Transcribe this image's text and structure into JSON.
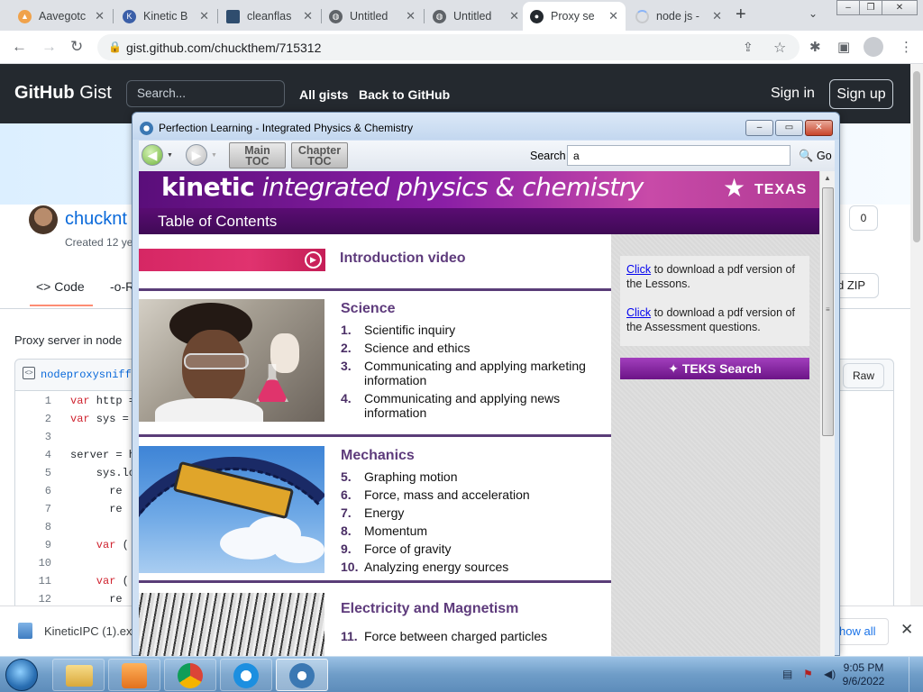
{
  "browser": {
    "tabs": [
      {
        "title": "Aavegotc",
        "favicon_color": "#f0a24b",
        "icon": "chart-icon"
      },
      {
        "title": "Kinetic B",
        "favicon_color": "#3b5fa8",
        "icon": "kinetic-k-icon"
      },
      {
        "title": "cleanflas",
        "favicon_color": "#2f4d6e",
        "icon": "square-icon"
      },
      {
        "title": "Untitled",
        "favicon_color": "#5f6368",
        "icon": "globe-icon"
      },
      {
        "title": "Untitled",
        "favicon_color": "#5f6368",
        "icon": "globe-icon"
      },
      {
        "title": "Proxy se",
        "favicon_color": "#24292f",
        "icon": "github-icon",
        "active": true
      },
      {
        "title": "node js -",
        "favicon_color": "#c7c9cc",
        "icon": "loading-icon"
      }
    ],
    "new_tab_label": "+",
    "url": "gist.github.com/chuckthem/715312",
    "window_controls": [
      "–",
      "❐",
      "✕"
    ]
  },
  "gist": {
    "logo_bold": "GitHub",
    "logo_light": "Gist",
    "search_placeholder": "Search...",
    "nav": [
      "All gists",
      "Back to GitHub"
    ],
    "signin": "Sign in",
    "signup": "Sign up",
    "username": "chucknt",
    "created": "Created 12 ye",
    "star_count": "0",
    "tab_code": "Code",
    "tab_revisions": "R",
    "zip_label": "d ZIP",
    "description": "Proxy server in node",
    "filename": "nodeproxysniffe",
    "raw_label": "Raw",
    "code_lines": [
      {
        "n": "1",
        "kw": "var",
        "rest": " http = "
      },
      {
        "n": "2",
        "kw": "var",
        "rest": " sys = "
      },
      {
        "n": "3",
        "kw": "",
        "rest": ""
      },
      {
        "n": "4",
        "kw": "",
        "rest": "server = ht"
      },
      {
        "n": "5",
        "kw": "",
        "rest": "    sys.lo"
      },
      {
        "n": "6",
        "kw": "",
        "rest": "      re"
      },
      {
        "n": "7",
        "kw": "",
        "rest": "      re"
      },
      {
        "n": "8",
        "kw": "",
        "rest": ""
      },
      {
        "n": "9",
        "kw": "    var",
        "rest": " ("
      },
      {
        "n": "10",
        "kw": "",
        "rest": ""
      },
      {
        "n": "11",
        "kw": "    var",
        "rest": " ("
      },
      {
        "n": "12",
        "kw": "",
        "rest": "      re"
      }
    ]
  },
  "download": {
    "filename": "KineticIPC (1).exe",
    "show_all": "how all",
    "close": "✕"
  },
  "kinetic": {
    "window_title": "Perfection Learning - Integrated Physics & Chemistry",
    "controls": {
      "minimize": "–",
      "maximize": "▭",
      "close": "✕"
    },
    "nav": {
      "back_glyph": "◀",
      "forward_glyph": "▶",
      "dropdown_glyph": "▼",
      "main_toc": [
        "Main",
        "TOC"
      ],
      "chapter_toc": [
        "Chapter",
        "TOC"
      ],
      "search_label": "Search",
      "search_value": "a",
      "go_label": "Go"
    },
    "banner": {
      "brand": "kinetic",
      "subtitle": " integrated physics & chemistry",
      "state": "TEXAS"
    },
    "toc_heading": "Table of Contents",
    "intro_video": "Introduction video",
    "sections": [
      {
        "title": "Science",
        "items": [
          {
            "num": "1.",
            "text": "Scientific inquiry"
          },
          {
            "num": "2.",
            "text": "Science and ethics"
          },
          {
            "num": "3.",
            "text": "Communicating and applying marketing information"
          },
          {
            "num": "4.",
            "text": "Communicating and applying news information"
          }
        ]
      },
      {
        "title": "Mechanics",
        "items": [
          {
            "num": "5.",
            "text": "Graphing motion"
          },
          {
            "num": "6.",
            "text": "Force, mass and acceleration"
          },
          {
            "num": "7.",
            "text": "Energy"
          },
          {
            "num": "8.",
            "text": "Momentum"
          },
          {
            "num": "9.",
            "text": "Force of gravity"
          },
          {
            "num": "10.",
            "text": "Analyzing energy sources"
          }
        ]
      },
      {
        "title": "Electricity and Magnetism",
        "items": [
          {
            "num": "11.",
            "text": "Force between charged particles"
          }
        ]
      }
    ],
    "sidebar": {
      "link_label": "Click",
      "lessons_text": " to download a pdf version of the Lessons.",
      "assessment_text": " to download a pdf version of the Assessment questions.",
      "teks_button": "TEKS Search"
    }
  },
  "taskbar": {
    "apps": [
      {
        "name": "explorer",
        "icon": "folder-icon"
      },
      {
        "name": "media-player",
        "icon": "media-player-icon"
      },
      {
        "name": "chrome",
        "icon": "chrome-icon"
      },
      {
        "name": "internet-explorer",
        "icon": "ie-icon"
      },
      {
        "name": "kinetic",
        "icon": "kinetic-app-icon",
        "active": true
      }
    ],
    "time": "9:05 PM",
    "date": "9/6/2022"
  },
  "colors": {
    "kinetic_purple": "#5a0c73",
    "section_title": "#5e3b7c",
    "intro_strip": "#d62764",
    "teks_button": "#6c1487"
  }
}
